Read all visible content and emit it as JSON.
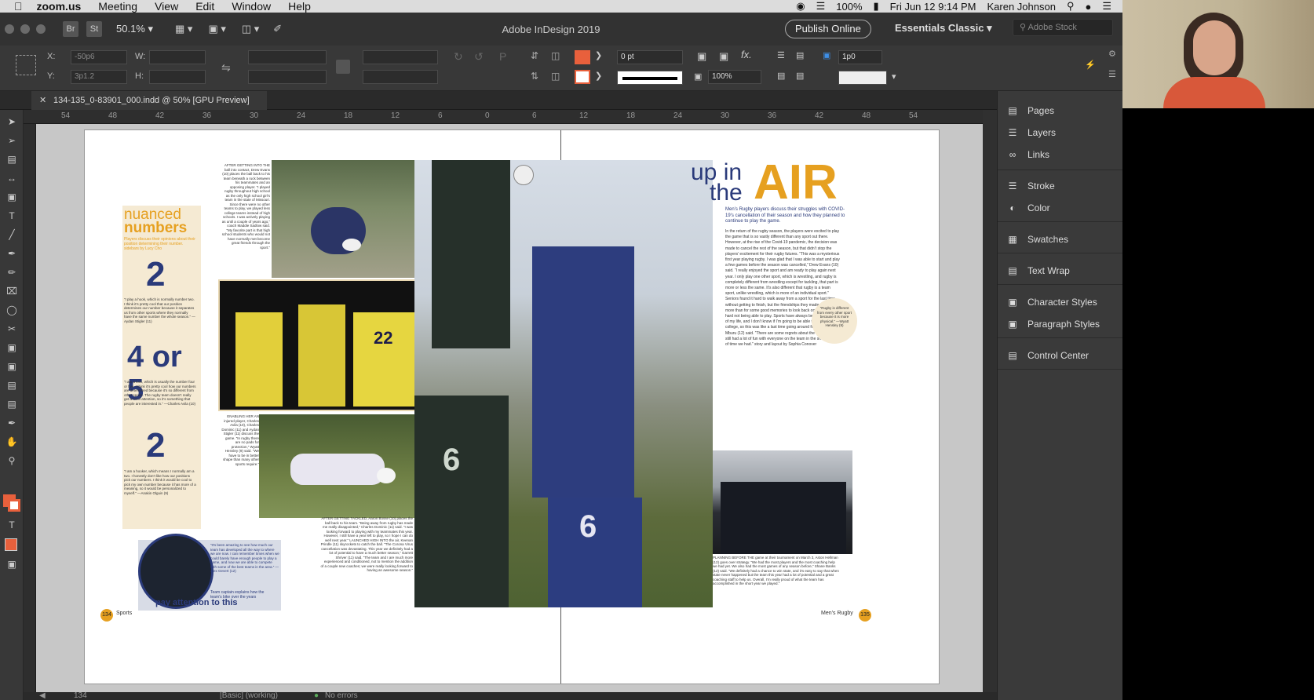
{
  "menubar": {
    "app": "zoom.us",
    "items": [
      "Meeting",
      "View",
      "Edit",
      "Window",
      "Help"
    ],
    "battery": "100%",
    "clock": "Fri Jun 12  9:14 PM",
    "user": "Karen Johnson"
  },
  "appbar": {
    "br": "Br",
    "st": "St",
    "zoom": "50.1%",
    "title": "Adobe InDesign 2019",
    "publish": "Publish Online",
    "workspace": "Essentials Classic",
    "stock_placeholder": "Adobe Stock"
  },
  "control": {
    "x_label": "X:",
    "y_label": "Y:",
    "w_label": "W:",
    "h_label": "H:",
    "x_value": "-50p6",
    "y_value": "3p1.2",
    "stroke_weight": "0 pt",
    "opacity": "100%",
    "spacing": "1p0",
    "fill_color": "#e8603c"
  },
  "doc_tab": "134-135_0-83901_000.indd @ 50% [GPU Preview]",
  "ruler": [
    "54",
    "48",
    "42",
    "36",
    "30",
    "24",
    "18",
    "12",
    "6",
    "0",
    "6",
    "12",
    "18",
    "24",
    "30",
    "36",
    "42",
    "48",
    "54"
  ],
  "spread": {
    "sidebar_title_1": "nuanced",
    "sidebar_title_2": "numbers",
    "sidebar_intro": "Players discuss their opinions about their position determining their number. sidebars by Lucy Cho",
    "num_1": "2",
    "num_2": "4 or 5",
    "num_3": "2",
    "quote_1": "“I play a hook, which is normally number two. I think it’s pretty cool that our position determines our number because it separates us from other sports where they normally have the same number the whole season.” —Aydan Stigler (11)",
    "quote_2": "“I am a lock, which is usually the number four or five. I think it’s pretty cool how our numbers are determined because it’s so different from other sports. The rugby team doesn’t really get a lot of attention, so it’s something that people are interested in.” —Charles Avila (10)",
    "quote_3": "“I am a hooker, which means I normally am a two. I honestly don’t like how our positions pick our numbers. I think it would be cool to pick my own number because it has more of a meaning, so it would be personalized to myself.” —Anakin Olguin (9)",
    "headline_1": "up in",
    "headline_2": "the",
    "headline_3": "AIR",
    "deck": "Men’s Rugby players discuss their struggles with COVID-19’s cancellation of their season and how they planned to continue to play the game.",
    "body": "In the return of the rugby season, the players were excited to play the game that is so vastly different than any sport out there. However, at the rise of the Covid-19 pandemic, the decision was made to cancel the rest of the season, but that didn’t stop the players’ excitement for their rugby futures. “This was a mysterious first year playing rugby. I was glad that I was able to start and play a few games before the season was cancelled,” Drew Evans (10) said. “I really enjoyed the sport and am ready to play again next year. I only play one other sport, which is wrestling, and rugby is completely different from wrestling except for tackling, that part is more or less the same. It’s also different that rugby is a team sport, unlike wrestling, which is more of an individual sport.” Seniors found it hard to walk away from a sport for the last time without getting to finish, but the friendships they made meant far more than for some good memories to look back on. “It’s really hard not being able to play. Sports have always been a huge part of my life, and I don’t know if I’m going to be able to play sports in college, so this was like a last time going around for me,” Samuel Mburu (12) said. “There are some regrets about the season, but I still had a lot of fun with everyone on the team in the short amount of time we had.” story and layout by Sophia Conover",
    "pull_quote": "“Rugby is different from every other sport because it is more physical.” —Wyatt Hensley (9)",
    "caption_left_top": "AFTER GETTING INTO THE ball into contact, Drew Evans (10) places the ball back to his team beneath a ruck between his teammates and an opposing player. “I played rugby throughout high school as the only high school girl’s team in the state of Missouri. Since there were no other teams to play, we played less college teams instead of high schools. I was actively playing as until a couple of years ago,” coach Maddie Sadlow said. “My favorite part is that high school students who would not have normally met become great friends through the sport.”",
    "caption_left_mid": "ENABLING HER AN injured player, Charles Avila (10), Charles Dominic (11) and Aydan Stigler (11) discuss the game. “In rugby there are no pads for protection,” Wyatt Hensley (9) said. “We have to be in better shape than many other sports require.”",
    "caption_bottom": "AFTER GETTING TACKLED, Aaron Bosse (10) places the ball back to his team. “Being away from rugby has made me really disappointed,” Charles Dominic (11) said. “I was looking forward to playing with my teammates this year. However, I still have a year left to play, so I hope I can do well next year.” LAUNCHED HIGH INTO the air, Keenan Prindle (11) skyrockets to catch the ball. “The Corona Virus cancellation was devastating. This year we definitely had a lot of potential to have a much better season,” Garrett Shriver (11) said. “The team and I are much more experienced and conditioned, not to mention the addition of a couple new coaches; we were really looking forward to having an awesome season.”",
    "caption_right": "PLANNING BEFORE THE game at their tournament on March 3, Aston Hellman (12) goes over strategy. “We had the most players and the most coaching help we had yet. We also had the most games of any season before,” Shane Banks (12) said. “We definitely had a chance to win state, and it’s easy to say that when state never happened but the team this year had a lot of potential and a great coaching staff to help us. Overall, I’m really proud of what the team has accomplished in the short year we played.”",
    "circle_quote": "“It’s been amazing to see how much our team has developed all the way to where we are now. I can remember times when we could barely have enough people to play a game, and now we are able to compete with some of the best teams in the area.” —Alex Gevert (12)",
    "circle_sub": "Team captain explains how the team’s bike over the years",
    "circle_headline": "pay attention to this",
    "folio_left_num": "134",
    "folio_left_label": "Sports",
    "folio_right_label": "Men’s Rugby",
    "folio_right_num": "135",
    "jersey_a": "6",
    "jersey_b": "6",
    "jersey_c": "22"
  },
  "panels": [
    {
      "icon": "pages-icon",
      "label": "Pages"
    },
    {
      "icon": "layers-icon",
      "label": "Layers"
    },
    {
      "icon": "links-icon",
      "label": "Links"
    },
    {
      "icon": "stroke-icon",
      "label": "Stroke"
    },
    {
      "icon": "color-icon",
      "label": "Color"
    },
    {
      "icon": "swatches-icon",
      "label": "Swatches"
    },
    {
      "icon": "text-wrap-icon",
      "label": "Text Wrap"
    },
    {
      "icon": "character-styles-icon",
      "label": "Character Styles"
    },
    {
      "icon": "paragraph-styles-icon",
      "label": "Paragraph Styles"
    },
    {
      "icon": "control-center-icon",
      "label": "Control Center"
    }
  ],
  "status": {
    "page": "134",
    "style": "[Basic] (working)",
    "errors": "No errors"
  },
  "colors": {
    "accent_gold": "#e6a020",
    "navy": "#2a3a7a",
    "panel_bg": "#3a3a3a"
  }
}
